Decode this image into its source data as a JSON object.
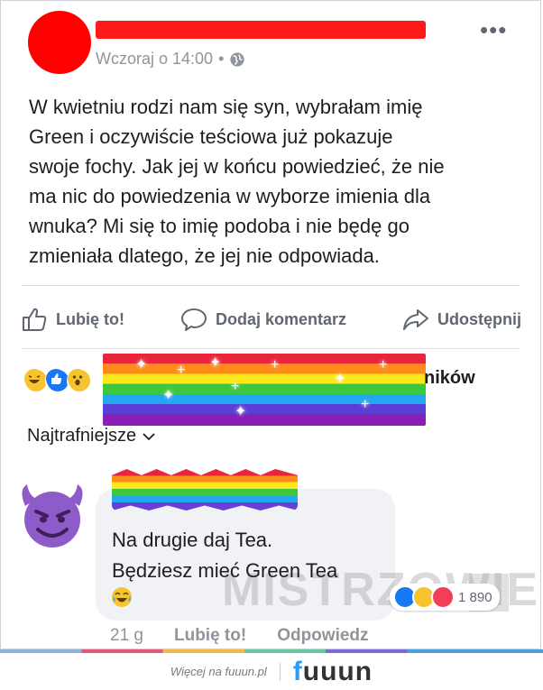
{
  "post": {
    "timestamp": "Wczoraj o 14:00",
    "more_label": "•••",
    "text": "W kwietniu rodzi nam się syn, wybrałam imię\nGreen i oczywiście teściowa już pokazuje\nswoje fochy. Jak jej w końcu powiedzieć, że nie\nma nic do powiedzenia w wyborze imienia dla\nwnuka? Mi się to imię podoba i nie będę go\nzmieniała dlatego, że jej nie odpowiada."
  },
  "actions": {
    "like": "Lubię to!",
    "comment": "Dodaj komentarz",
    "share": "Udostępnij"
  },
  "reactions_bar": {
    "counter_suffix": "ników"
  },
  "sort": {
    "label": "Najtrafniejsze"
  },
  "comment": {
    "text": "Na drugie daj Tea.\nBędziesz mieć Green Tea",
    "reaction_count": "1 890",
    "time": "21 g",
    "like": "Lubię to!",
    "reply": "Odpowiedz"
  },
  "watermark": "MISTRZOWIE",
  "footer": {
    "more_link": "Więcej na fuuun.pl",
    "logo_prefix": "f",
    "logo_rest": "uuun"
  },
  "colors": {
    "facebook_blue": "#1877f2",
    "redaction_red": "#ff0000",
    "muted_text": "#90949c"
  }
}
